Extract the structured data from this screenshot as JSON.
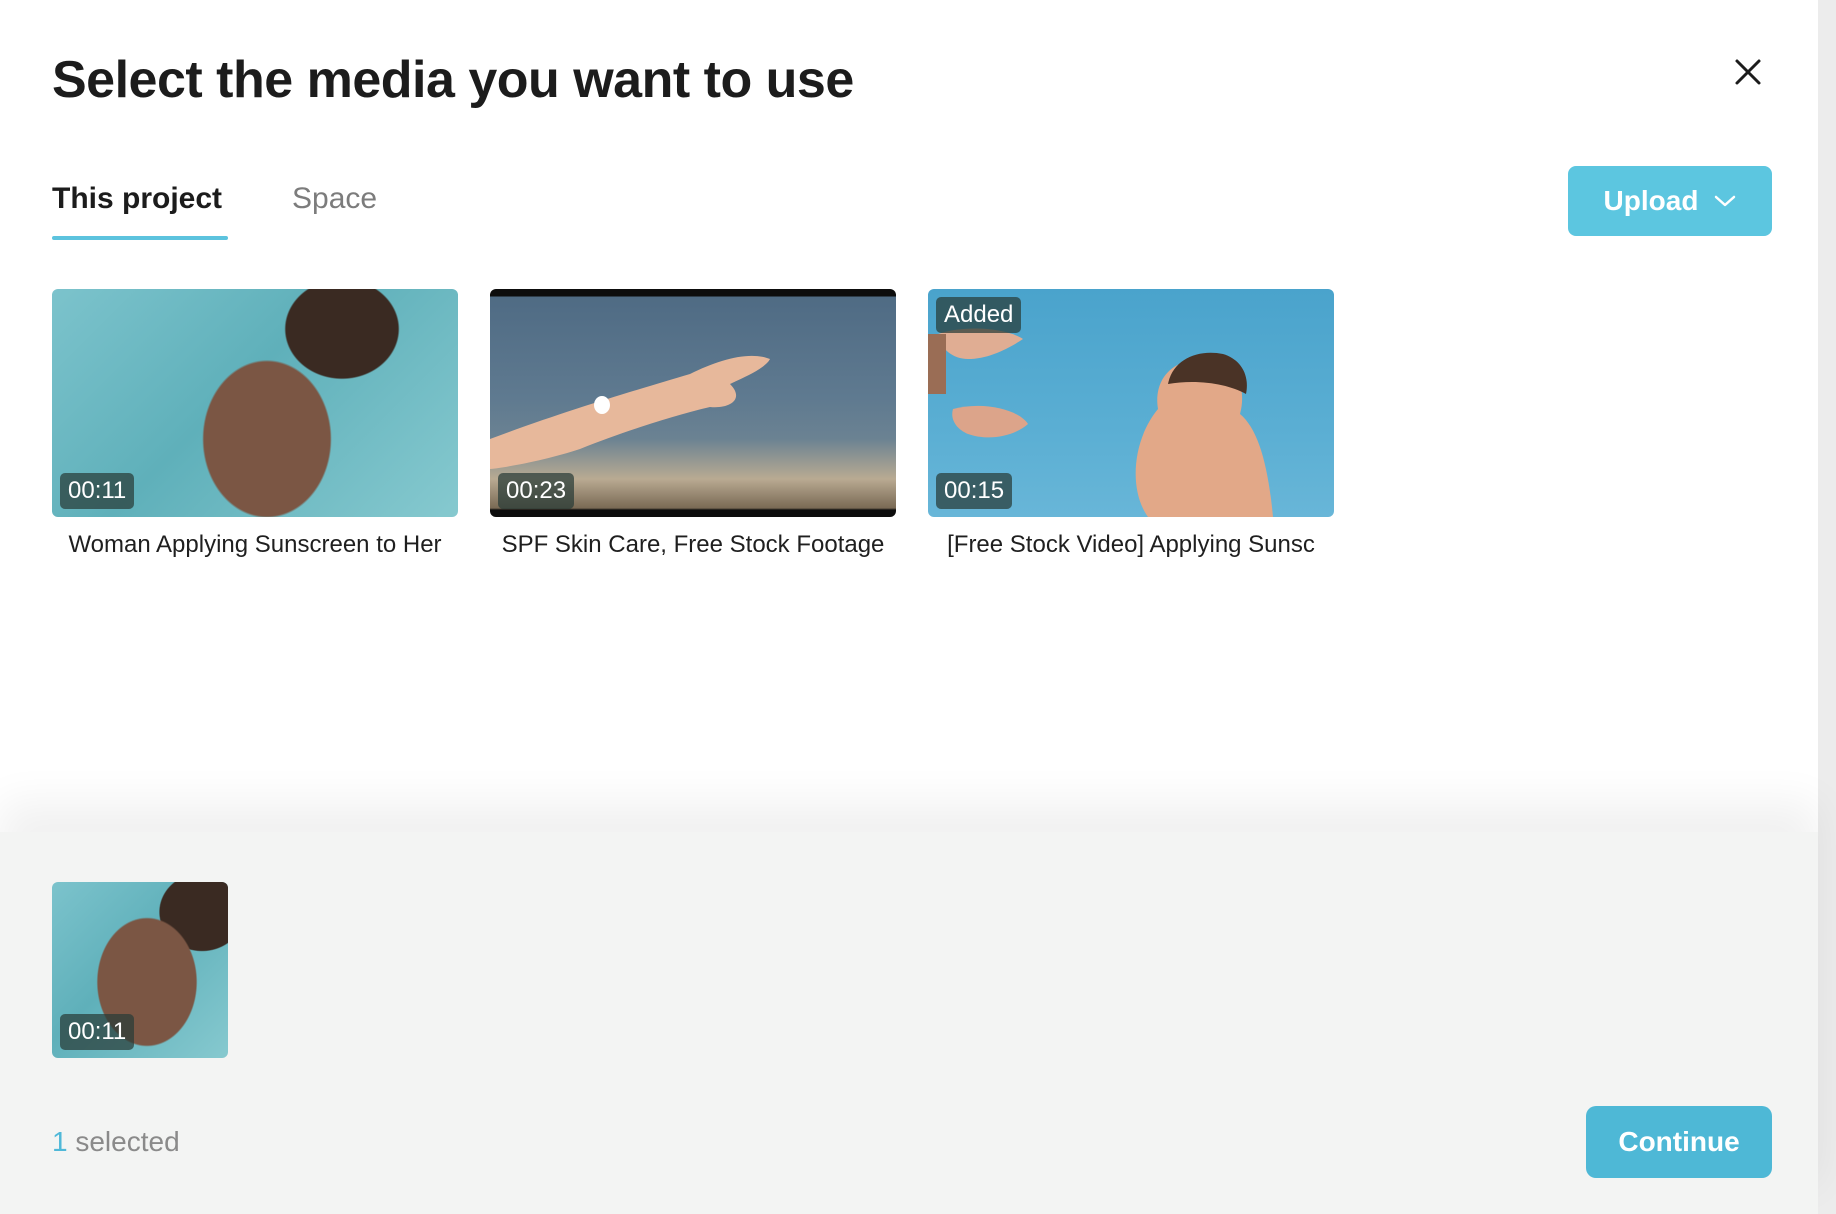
{
  "dialog": {
    "title": "Select the media you want to use"
  },
  "tabs": [
    {
      "label": "This project",
      "active": true
    },
    {
      "label": "Space",
      "active": false
    }
  ],
  "upload": {
    "label": "Upload"
  },
  "media": [
    {
      "title": "Woman Applying Sunscreen to Her",
      "duration": "00:11",
      "badge": ""
    },
    {
      "title": "SPF Skin Care, Free Stock Footage",
      "duration": "00:23",
      "badge": ""
    },
    {
      "title": "[Free Stock Video] Applying Sunsc",
      "duration": "00:15",
      "badge": "Added"
    }
  ],
  "selection": {
    "items": [
      {
        "duration": "00:11"
      }
    ],
    "count": "1",
    "count_suffix": " selected"
  },
  "continue": {
    "label": "Continue"
  },
  "colors": {
    "accent": "#5cc6e0",
    "continue_button": "#4eb8d6",
    "tray_background": "#f3f4f3"
  }
}
